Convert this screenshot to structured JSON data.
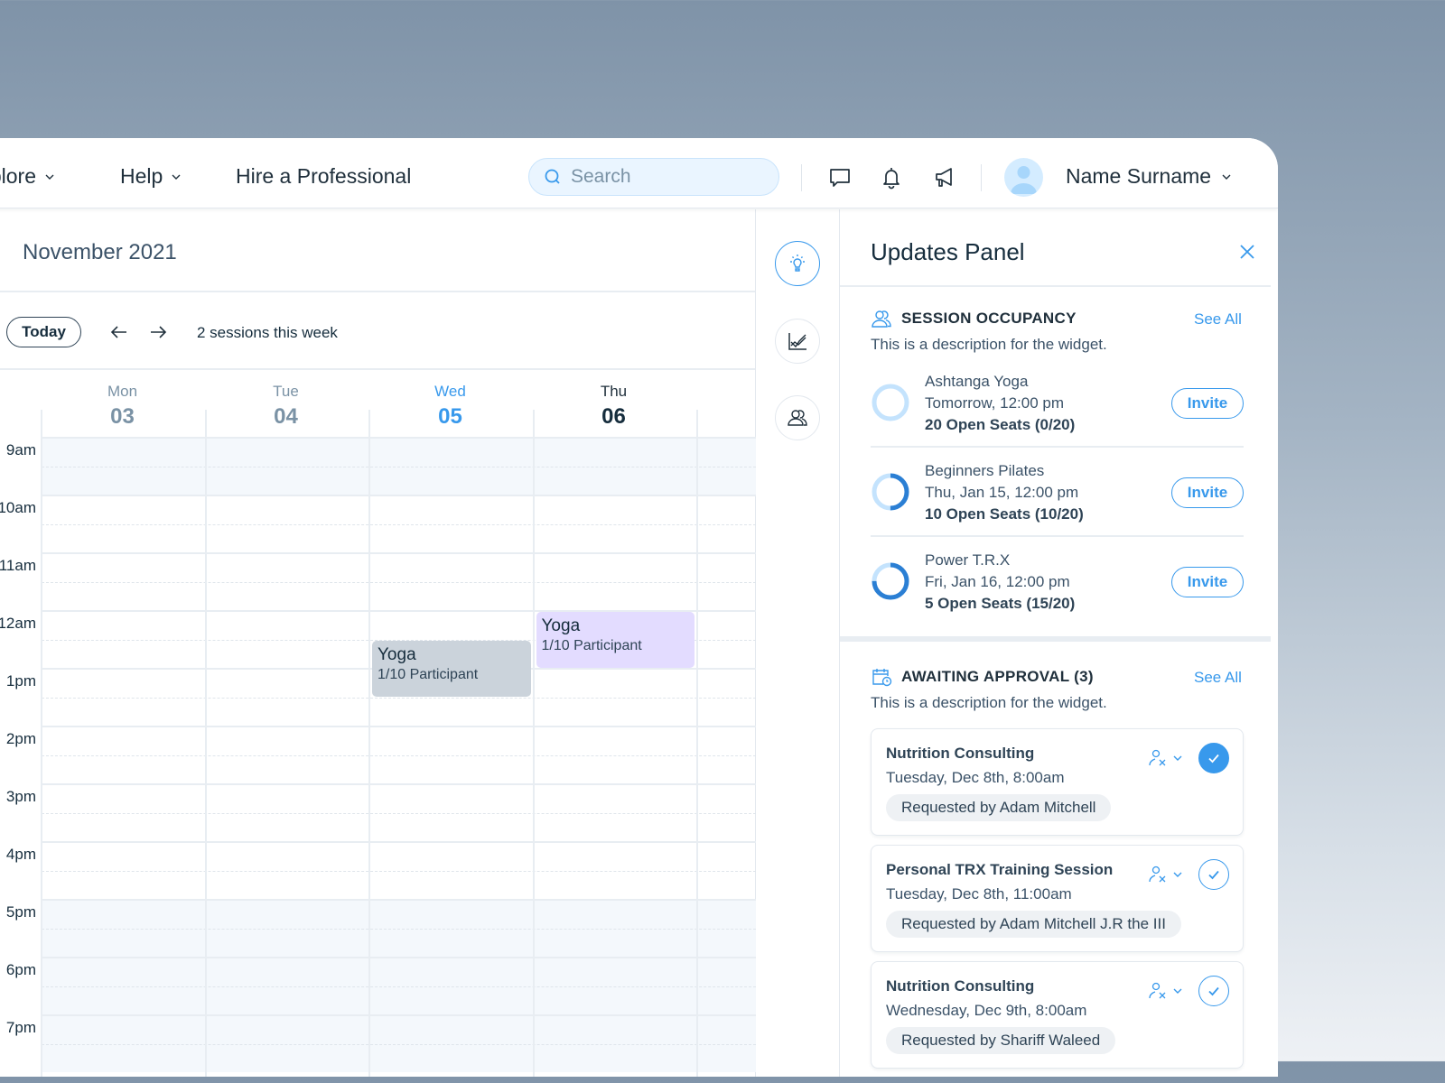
{
  "topbar": {
    "nav": [
      {
        "label": "Explore",
        "has_dropdown": true
      },
      {
        "label": "Help",
        "has_dropdown": true
      },
      {
        "label": "Hire a Professional",
        "has_dropdown": false
      }
    ],
    "search_placeholder": "Search",
    "icons": [
      "chat-icon",
      "bell-icon",
      "megaphone-icon"
    ],
    "user_name": "Name Surname"
  },
  "calendar": {
    "title_partial": "r",
    "month": "November 2021",
    "today_label": "Today",
    "sessions_text": "2 sessions this week",
    "days": [
      {
        "name": "Mon",
        "num": "03",
        "state": "normal"
      },
      {
        "name": "Tue",
        "num": "04",
        "state": "normal"
      },
      {
        "name": "Wed",
        "num": "05",
        "state": "today"
      },
      {
        "name": "Thu",
        "num": "06",
        "state": "selected"
      }
    ],
    "hours": [
      "9am",
      "10am",
      "11am",
      "12am",
      "1pm",
      "2pm",
      "3pm",
      "4pm",
      "5pm",
      "6pm",
      "7pm"
    ],
    "off_hours": [
      "9am",
      "5pm",
      "6pm",
      "7pm"
    ],
    "events": [
      {
        "title": "Yoga",
        "subtitle": "1/10 Participant",
        "day": "Wed",
        "start_hour": 12.5,
        "end_hour": 13.5,
        "color": "#cbd3db"
      },
      {
        "title": "Yoga",
        "subtitle": "1/10 Participant",
        "day": "Thu",
        "start_hour": 12.0,
        "end_hour": 13.0,
        "color": "#e3dcff"
      }
    ]
  },
  "rail": {
    "buttons": [
      {
        "icon": "lightbulb-icon",
        "active": true
      },
      {
        "icon": "chart-icon",
        "active": false
      },
      {
        "icon": "users-icon",
        "active": false
      }
    ]
  },
  "panel": {
    "title": "Updates Panel",
    "occupancy": {
      "title": "SESSION OCCUPANCY",
      "see_all": "See All",
      "description": "This is a description for the widget.",
      "items": [
        {
          "name": "Ashtanga Yoga",
          "time": "Tomorrow, 12:00 pm",
          "seats": "20 Open Seats (0/20)",
          "filled": 0,
          "capacity": 20,
          "action": "Invite"
        },
        {
          "name": "Beginners Pilates",
          "time": "Thu, Jan 15, 12:00 pm",
          "seats": "10 Open Seats (10/20)",
          "filled": 10,
          "capacity": 20,
          "action": "Invite"
        },
        {
          "name": "Power T.R.X",
          "time": "Fri, Jan 16, 12:00 pm",
          "seats": "5 Open Seats (15/20)",
          "filled": 15,
          "capacity": 20,
          "action": "Invite"
        }
      ]
    },
    "approval": {
      "title": "AWAITING APPROVAL (3)",
      "see_all": "See All",
      "description": "This is a description for the widget.",
      "items": [
        {
          "title": "Nutrition Consulting",
          "time": "Tuesday, Dec 8th, 8:00am",
          "requested_by": "Requested by Adam Mitchell",
          "approved_state": "filled"
        },
        {
          "title": "Personal TRX Training Session",
          "time": "Tuesday, Dec 8th, 11:00am",
          "requested_by": "Requested by Adam Mitchell J.R the III",
          "approved_state": "outline"
        },
        {
          "title": "Nutrition Consulting",
          "time": "Wednesday, Dec 9th, 8:00am",
          "requested_by": "Requested by Shariff Waleed",
          "approved_state": "outline"
        }
      ]
    }
  },
  "colors": {
    "accent": "#3899ec",
    "text_primary": "#162d3d",
    "ring_track": "#c4e3fd",
    "ring_fill": "#2b7fd4"
  }
}
